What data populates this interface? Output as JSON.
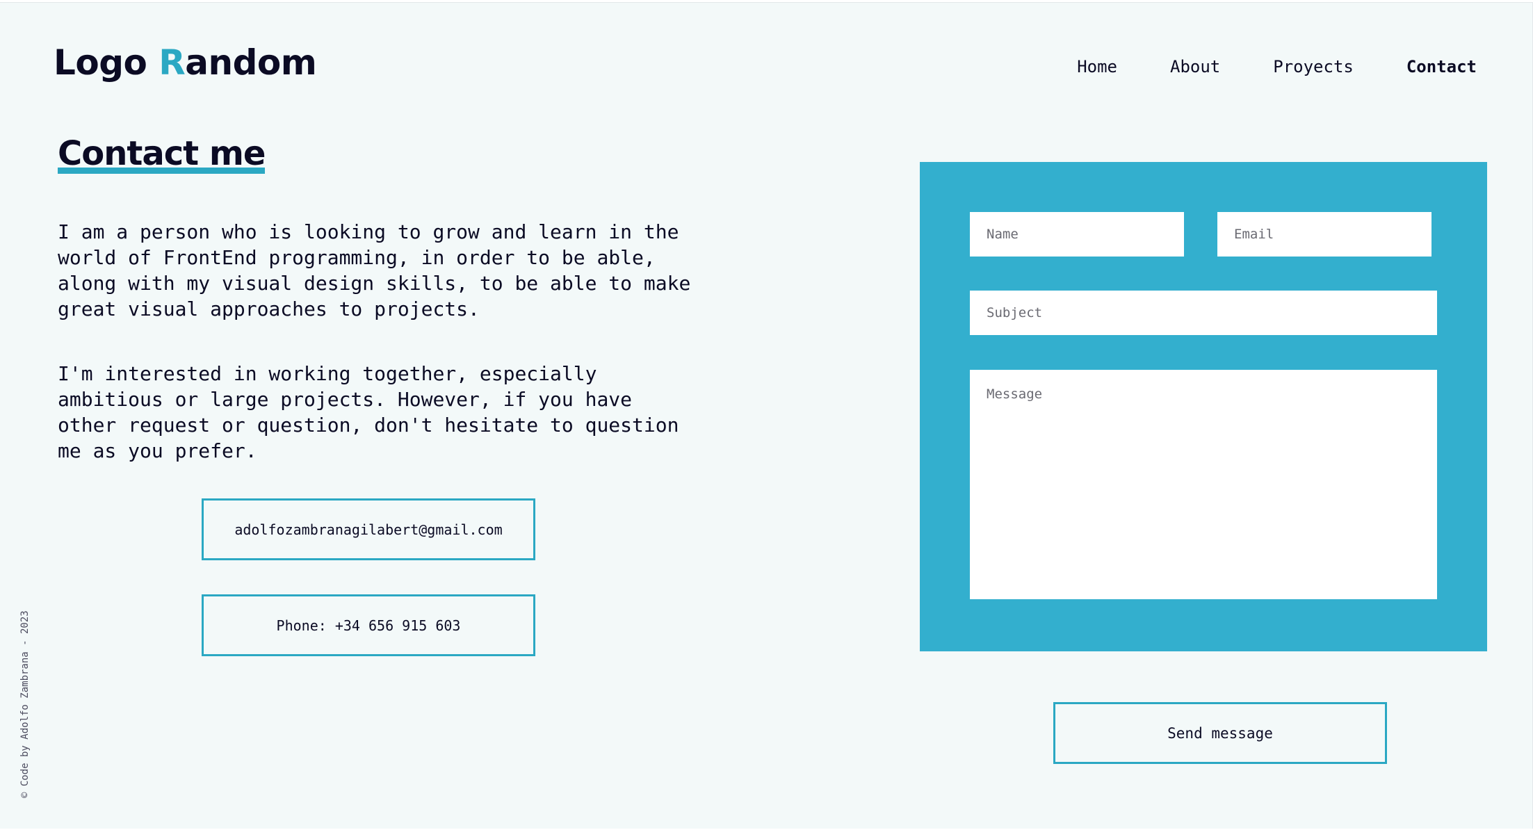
{
  "header": {
    "logo_prefix": "Logo ",
    "logo_accent": "R",
    "logo_suffix": "andom",
    "nav": [
      {
        "label": "Home"
      },
      {
        "label": "About"
      },
      {
        "label": "Proyects"
      },
      {
        "label": "Contact",
        "active": true
      }
    ]
  },
  "main": {
    "title": "Contact me",
    "paragraph1": "I am a person who is looking to grow and learn in the world of FrontEnd programming, in order to be able, along with my visual design skills, to be able to make great visual approaches to projects.",
    "paragraph2": "I'm interested in working together, especially ambitious or large projects. However, if you have other request or question, don't hesitate to question me as you prefer.",
    "email": "adolfozambranagilabert@gmail.com",
    "phone": "Phone: +34 656 915 603"
  },
  "form": {
    "name_placeholder": "Name",
    "email_placeholder": "Email",
    "subject_placeholder": "Subject",
    "message_placeholder": "Message",
    "send_label": "Send message"
  },
  "footer": {
    "credit": "© Code by Adolfo Zambrana - 2023"
  },
  "colors": {
    "accent": "#2ba8c3",
    "panel": "#33afce",
    "background": "#f3f9f9",
    "text": "#0b0b24"
  }
}
